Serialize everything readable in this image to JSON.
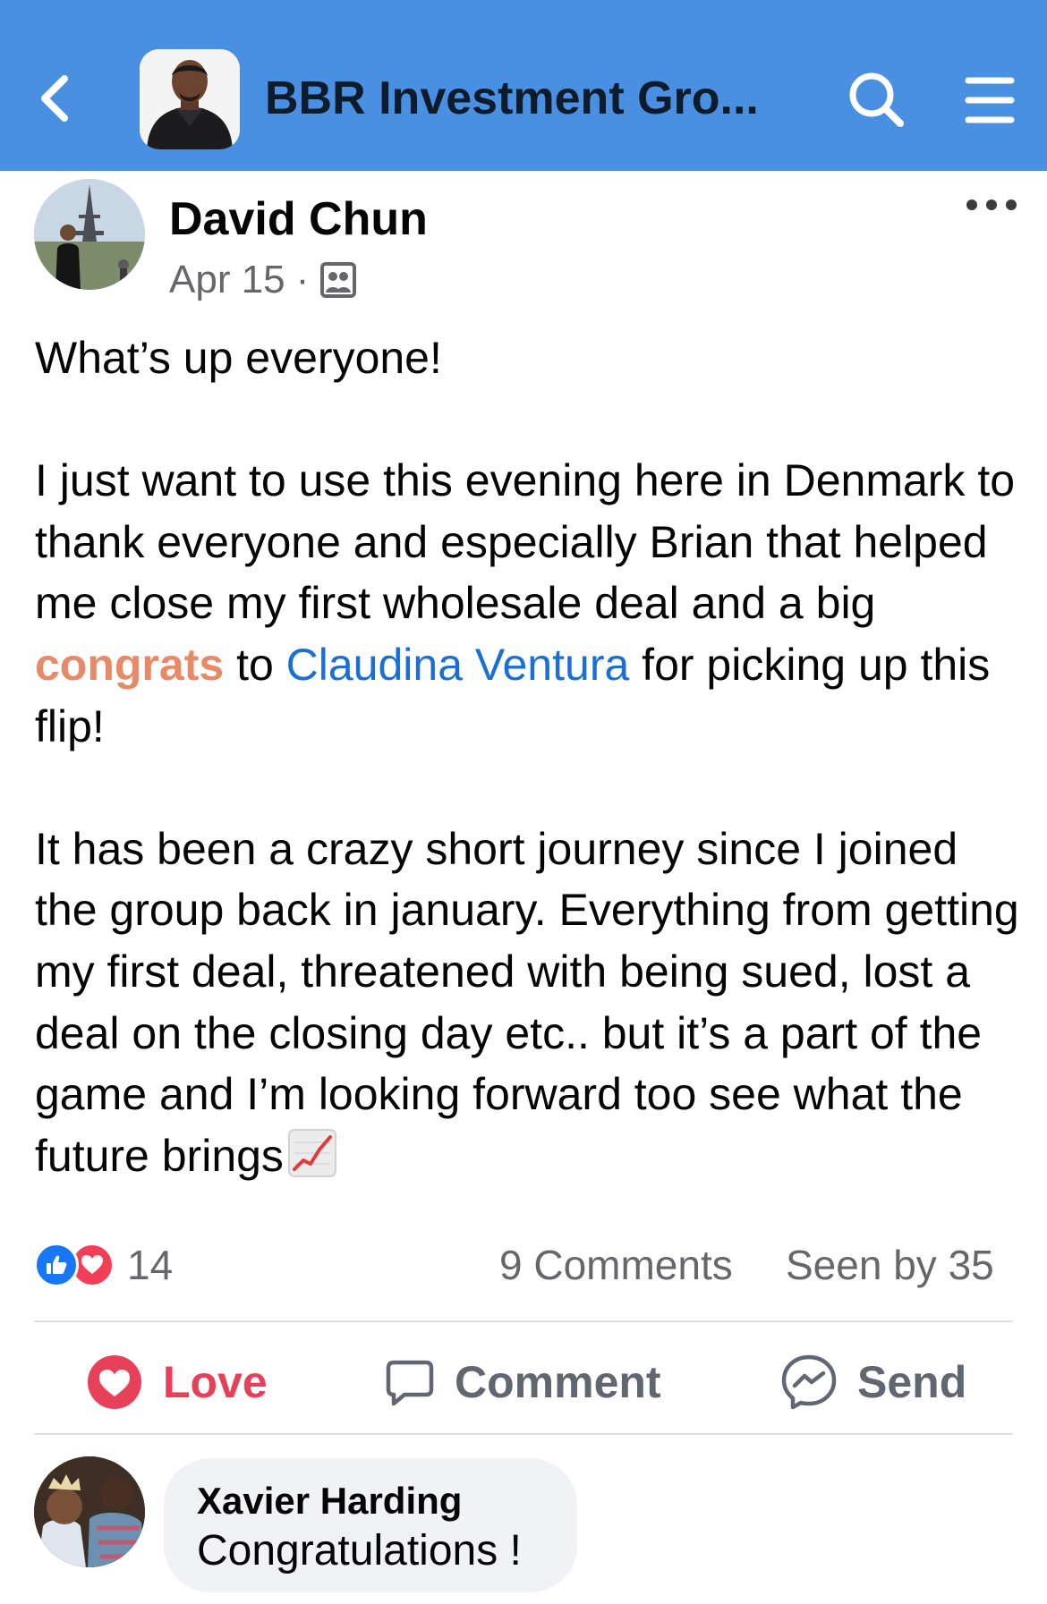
{
  "header": {
    "back_icon": "chevron-left-icon",
    "group_title": "BBR Investment Gro...",
    "search_icon": "search-icon",
    "menu_icon": "hamburger-menu-icon",
    "background_color": "#4a90e2"
  },
  "post": {
    "author_name": "David Chun",
    "date": "Apr 15",
    "separator": "·",
    "audience_icon": "group-audience-icon",
    "more_icon": "more-options-icon",
    "greeting": "What’s up everyone!",
    "paragraph2": {
      "before_congrats": "I just want to use this evening here in Denmark  to thank everyone and especially Brian that helped me close my first wholesale deal and a big ",
      "congrats": "congrats",
      "to": " to ",
      "mention": "Claudina Ventura",
      "after_mention": " for picking up this flip!"
    },
    "paragraph3": "It has been a crazy short journey since I joined the group back in january. Everything from getting my first deal, threatened with being sued, lost a deal on the closing day etc.. but it’s a part of the game and I’m looking forward too see what the future brings",
    "emoji": "chart-increasing-icon"
  },
  "stats": {
    "reaction_count": "14",
    "comments": "9 Comments",
    "seen_by": "Seen by 35",
    "reaction_icons": [
      "like-reaction-icon",
      "love-reaction-icon"
    ]
  },
  "actions": {
    "love_label": "Love",
    "comment_label": "Comment",
    "send_label": "Send",
    "love_color": "#e7415a"
  },
  "comment": {
    "author": "Xavier Harding",
    "text": "Congratulations !"
  }
}
